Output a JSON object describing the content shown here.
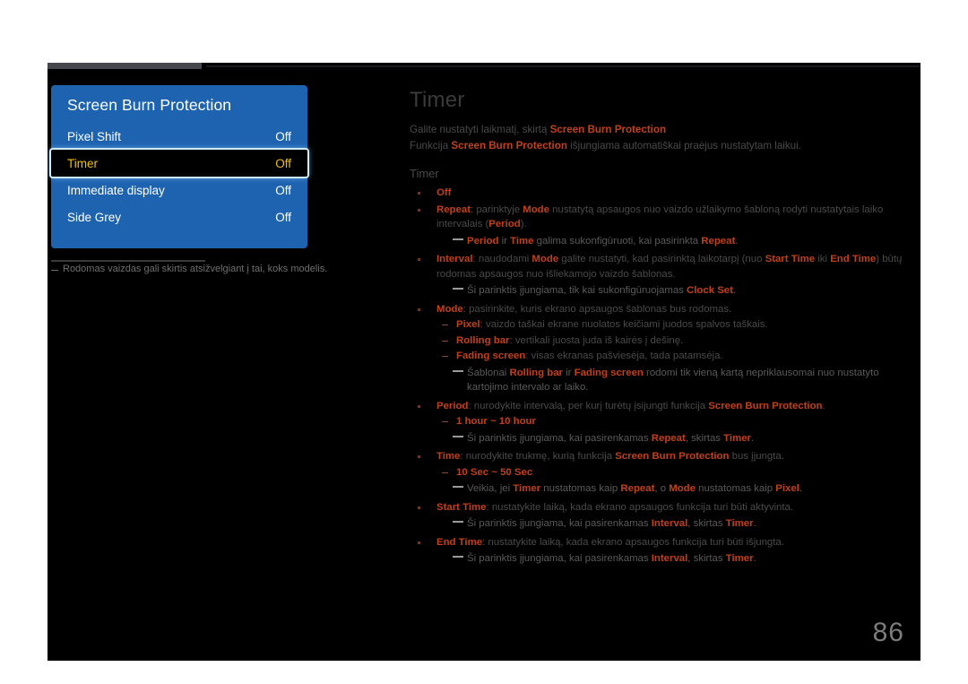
{
  "page": {
    "number": "86",
    "tab_label": ""
  },
  "osd": {
    "title": "Screen Burn Protection",
    "items": [
      {
        "label": "Pixel Shift",
        "value": "Off",
        "selected": false
      },
      {
        "label": "Timer",
        "value": "Off",
        "selected": true
      },
      {
        "label": "Immediate display",
        "value": "Off",
        "selected": false
      },
      {
        "label": "Side Grey",
        "value": "Off",
        "selected": false
      }
    ],
    "footnote": "Rodomas vaizdas gali skirtis atsižvelgiant į tai, koks modelis."
  },
  "colors": {
    "osd_blue": "#1e63b0",
    "selection_gold": "#f0c000",
    "selection_border": "#cfe9ff",
    "accent_orange": "#c0401a",
    "canvas_black": "#000000",
    "page_white": "#ffffff"
  },
  "article": {
    "title": "Timer",
    "lead_line_1_a": "Galite nustatyti laikmatį, skirtą ",
    "lead_line_1_b": "Screen Burn Protection",
    "lead_line_2_a": "Funkcija ",
    "lead_line_2_b": "Screen Burn Protection",
    "lead_line_2_c": " išjungiama automatiškai praėjus nustatytam laikui.",
    "section_heading": "Timer",
    "items": {
      "off": "Off",
      "repeat_term": "Repeat",
      "repeat_text_a": ": parinktyje ",
      "repeat_mode": "Mode",
      "repeat_text_b": " nustatytą apsaugos nuo vaizdo užlaikymo šabloną rodyti nustatytais laiko intervalais (",
      "repeat_period": "Period",
      "repeat_text_c": ").",
      "note_period_a": "Period",
      "note_period_b": " ir ",
      "note_period_c": "Time",
      "note_period_d": " galima sukonfigūruoti, kai pasirinkta ",
      "note_period_e": "Repeat",
      "note_period_f": ".",
      "interval_term": "Interval",
      "interval_text_a": ": naudodami ",
      "interval_mode": "Mode",
      "interval_text_b": " galite nustatyti, kad pasirinktą laikotarpį (nuo ",
      "interval_start": "Start Time",
      "interval_text_c": " iki ",
      "interval_end": "End Time",
      "interval_text_d": ") būtų rodomas apsaugos nuo išliekamojo vaizdo šablonas.",
      "note_clock_a": "Ši parinktis įjungiama, tik kai sukonfigūruojamas ",
      "note_clock_b": "Clock Set",
      "note_clock_c": ".",
      "mode_term": "Mode",
      "mode_text": ": pasirinkite, kuris ekrano apsaugos šablonas bus rodomas.",
      "mode_pixel_term": "Pixel",
      "mode_pixel_text": ": vaizdo taškai ekrane nuolatos keičiami juodos spalvos taškais.",
      "mode_rolling_term": "Rolling bar",
      "mode_rolling_text": ": vertikali juosta juda iš kairės į dešinę.",
      "mode_fading_term": "Fading screen",
      "mode_fading_text": ": visas ekranas pašviesėja, tada patamsėja.",
      "note_templates_a": "Šablonai ",
      "note_templates_b": "Rolling bar",
      "note_templates_c": " ir ",
      "note_templates_d": "Fading screen",
      "note_templates_e": " rodomi tik vieną kartą nepriklausomai nuo nustatyto kartojimo intervalo ar laiko.",
      "period_term": "Period",
      "period_text_a": ": nurodykite intervalą, per kurį turėtų įsijungti funkcija ",
      "period_text_b": "Screen Burn Protection",
      "period_text_c": ".",
      "period_range": "1 hour ~ 10 hour",
      "note_repeat_a": "Ši parinktis įjungiama, kai pasirenkamas ",
      "note_repeat_b": "Repeat",
      "note_repeat_c": ", skirtas ",
      "note_repeat_d": "Timer",
      "note_repeat_e": ".",
      "time_term": "Time",
      "time_text_a": ": nurodykite trukmę, kurią funkcija ",
      "time_text_b": "Screen Burn Protection",
      "time_text_c": " bus įjungta.",
      "time_range": "10 Sec ~ 50 Sec",
      "note_works_a": "Veikia, jei ",
      "note_works_b": "Timer",
      "note_works_c": " nustatomas kaip ",
      "note_works_d": "Repeat",
      "note_works_e": ", o ",
      "note_works_f": "Mode",
      "note_works_g": " nustatomas kaip ",
      "note_works_h": "Pixel",
      "note_works_i": ".",
      "start_time_term": "Start Time",
      "start_time_text": ": nustatykite laiką, kada ekrano apsaugos funkcija turi būti aktyvinta.",
      "note_interval_a": "Ši parinktis įjungiama, kai pasirenkamas ",
      "note_interval_b": "Interval",
      "note_interval_c": ", skirtas ",
      "note_interval_d": "Timer",
      "note_interval_e": ".",
      "end_time_term": "End Time",
      "end_time_text": ": nustatykite laiką, kada ekrano apsaugos funkcija turi būti išjungta.",
      "note_interval2_a": "Ši parinktis įjungiama, kai pasirenkamas ",
      "note_interval2_b": "Interval",
      "note_interval2_c": ", skirtas ",
      "note_interval2_d": "Timer",
      "note_interval2_e": "."
    }
  }
}
